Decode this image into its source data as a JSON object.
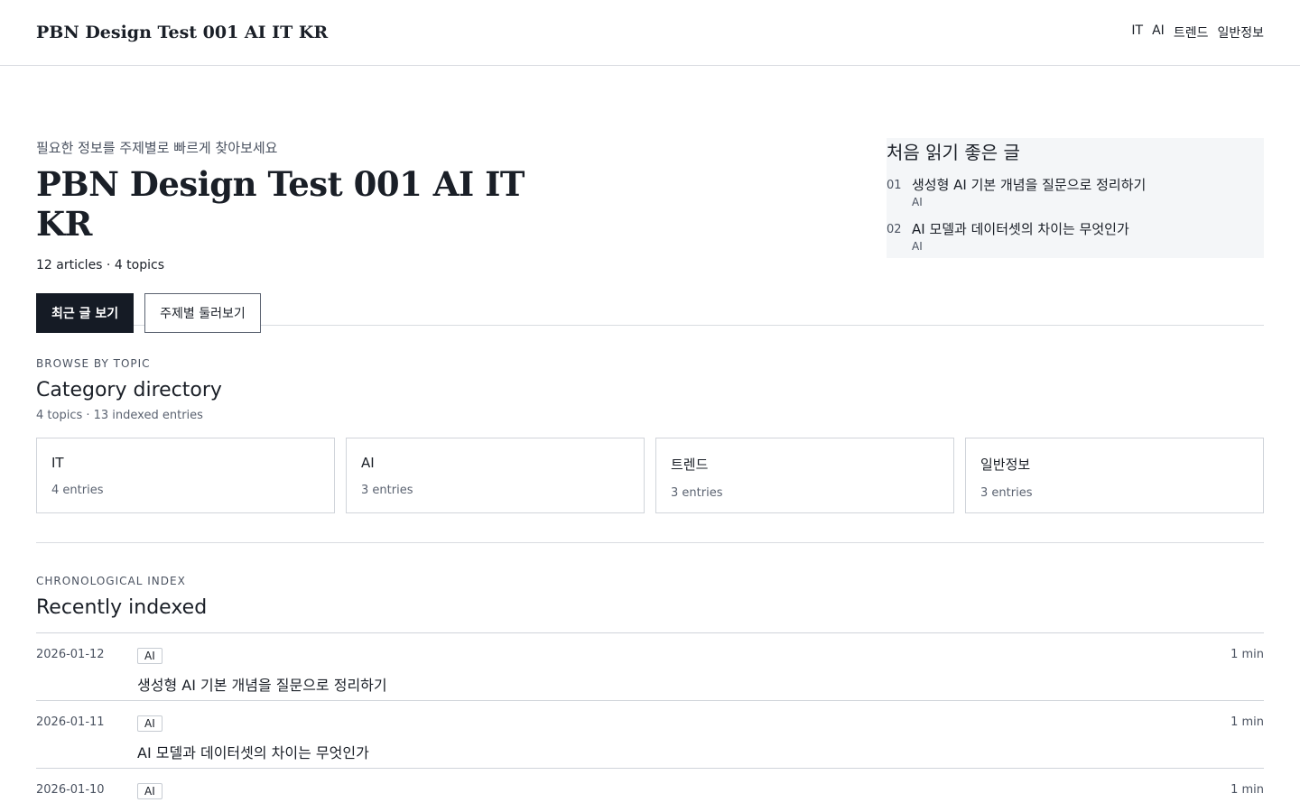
{
  "header": {
    "brand": "PBN Design Test 001 AI IT KR",
    "nav": [
      "IT",
      "AI",
      "트렌드",
      "일반정보"
    ]
  },
  "hero": {
    "eyebrow": "필요한 정보를 주제별로 빠르게 찾아보세요",
    "title": "PBN Design Test 001 AI IT KR",
    "meta": "12 articles · 4 topics",
    "primary_button": "최근 글 보기",
    "secondary_button": "주제별 둘러보기"
  },
  "starter": {
    "title": "처음 읽기 좋은 글",
    "items": [
      {
        "num": "01",
        "title": "생성형 AI 기본 개념을 질문으로 정리하기",
        "category": "AI"
      },
      {
        "num": "02",
        "title": "AI 모델과 데이터셋의 차이는 무엇인가",
        "category": "AI"
      }
    ]
  },
  "categories": {
    "label": "BROWSE BY TOPIC",
    "title": "Category directory",
    "sub": "4 topics · 13 indexed entries",
    "items": [
      {
        "name": "IT",
        "count": "4 entries"
      },
      {
        "name": "AI",
        "count": "3 entries"
      },
      {
        "name": "트렌드",
        "count": "3 entries"
      },
      {
        "name": "일반정보",
        "count": "3 entries"
      }
    ]
  },
  "recent": {
    "label": "CHRONOLOGICAL INDEX",
    "title": "Recently indexed",
    "rows": [
      {
        "date": "2026-01-12",
        "tag": "AI",
        "title": "생성형 AI 기본 개념을 질문으로 정리하기",
        "min": "1 min"
      },
      {
        "date": "2026-01-11",
        "tag": "AI",
        "title": "AI 모델과 데이터셋의 차이는 무엇인가",
        "min": "1 min"
      },
      {
        "date": "2026-01-10",
        "tag": "AI",
        "title": "",
        "min": "1 min"
      }
    ]
  }
}
